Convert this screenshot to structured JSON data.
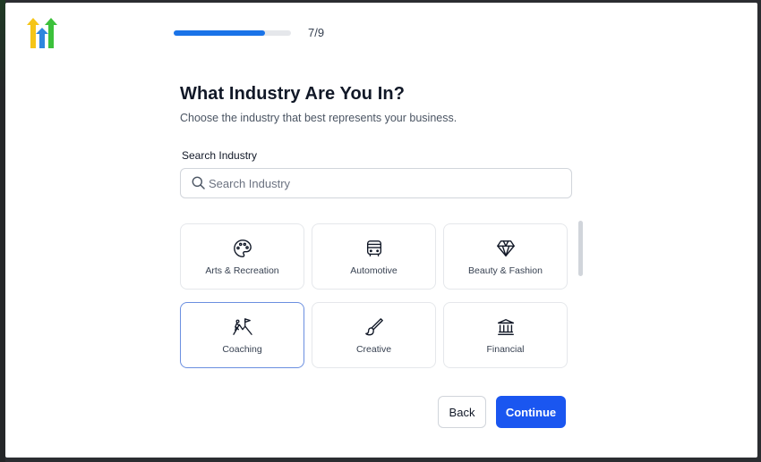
{
  "header": {
    "logo": "gohighlevel-arrows-logo",
    "progress": 0.78,
    "step": "7/9"
  },
  "main": {
    "title": "What Industry Are You In?",
    "subtitle": "Choose the industry that best represents your business.",
    "search": {
      "label": "Search Industry",
      "placeholder": "Search Industry",
      "value": "",
      "icon": "search-icon"
    },
    "industries": [
      {
        "label": "Arts & Recreation",
        "icon": "palette-icon",
        "selected": false
      },
      {
        "label": "Automotive",
        "icon": "bus-icon",
        "selected": false
      },
      {
        "label": "Beauty & Fashion",
        "icon": "diamond-icon",
        "selected": false
      },
      {
        "label": "Coaching",
        "icon": "mountain-flag-icon",
        "selected": true
      },
      {
        "label": "Creative",
        "icon": "paintbrush-icon",
        "selected": false
      },
      {
        "label": "Financial",
        "icon": "bank-icon",
        "selected": false
      }
    ]
  },
  "footer": {
    "back_label": "Back",
    "continue_label": "Continue"
  },
  "colors": {
    "accent": "#1a56f0",
    "progress": "#1a73e8",
    "selected_border": "#6b8fe0",
    "logo_yellow": "#f5c518",
    "logo_blue": "#2e86de",
    "logo_green": "#3cc13b"
  }
}
